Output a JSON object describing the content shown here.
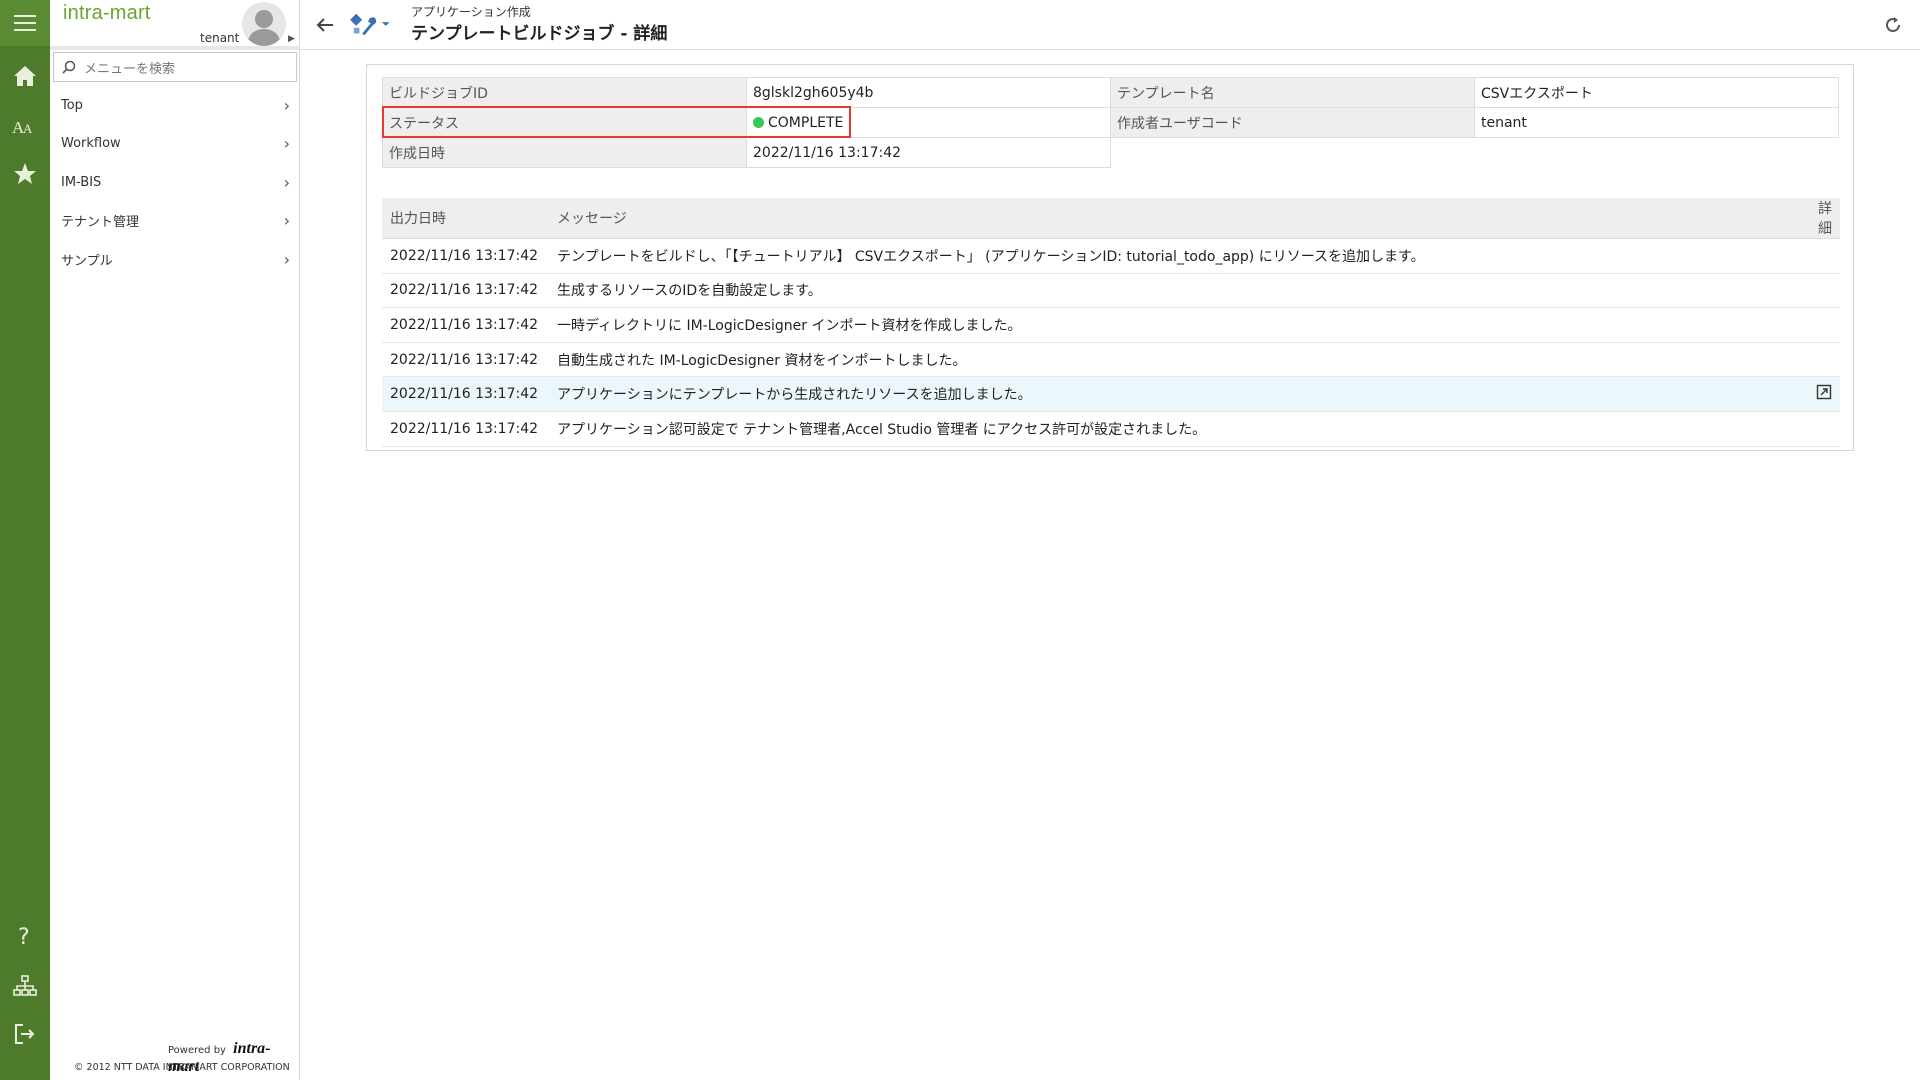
{
  "brand": "intra-mart",
  "user": {
    "name": "tenant"
  },
  "search": {
    "placeholder": "メニューを検索"
  },
  "menu": [
    {
      "label": "Top"
    },
    {
      "label": "Workflow"
    },
    {
      "label": "IM-BIS"
    },
    {
      "label": "テナント管理"
    },
    {
      "label": "サンプル"
    }
  ],
  "footer": {
    "powered_by": "Powered by",
    "logo_text": "intra-mart",
    "copyright": "© 2012 NTT DATA INTRAMART CORPORATION"
  },
  "header": {
    "breadcrumb": "アプリケーション作成",
    "title": "テンプレートビルドジョブ - 詳細"
  },
  "info": {
    "build_job_id_label": "ビルドジョブID",
    "build_job_id": "8glskl2gh605y4b",
    "template_name_label": "テンプレート名",
    "template_name": "CSVエクスポート",
    "status_label": "ステータス",
    "status": "COMPLETE",
    "author_label": "作成者ユーザコード",
    "author": "tenant",
    "created_label": "作成日時",
    "created": "2022/11/16 13:17:42"
  },
  "log": {
    "columns": {
      "time": "出力日時",
      "message": "メッセージ",
      "detail": "詳細"
    },
    "rows": [
      {
        "time": "2022/11/16 13:17:42",
        "message": "テンプレートをビルドし、「【チュートリアル】 CSVエクスポート」 (アプリケーションID: tutorial_todo_app) にリソースを追加します。"
      },
      {
        "time": "2022/11/16 13:17:42",
        "message": "生成するリソースのIDを自動設定します。"
      },
      {
        "time": "2022/11/16 13:17:42",
        "message": "一時ディレクトリに IM-LogicDesigner インポート資材を作成しました。"
      },
      {
        "time": "2022/11/16 13:17:42",
        "message": "自動生成された IM-LogicDesigner 資材をインポートしました。"
      },
      {
        "time": "2022/11/16 13:17:42",
        "message": "アプリケーションにテンプレートから生成されたリソースを追加しました。"
      },
      {
        "time": "2022/11/16 13:17:42",
        "message": "アプリケーション認可設定で テナント管理者,Accel Studio 管理者 にアクセス許可が設定されました。"
      }
    ]
  },
  "colors": {
    "rail": "#4e7a2c",
    "brand": "#6aa52f",
    "status_dot": "#34c759",
    "highlight_border": "#e53935"
  }
}
